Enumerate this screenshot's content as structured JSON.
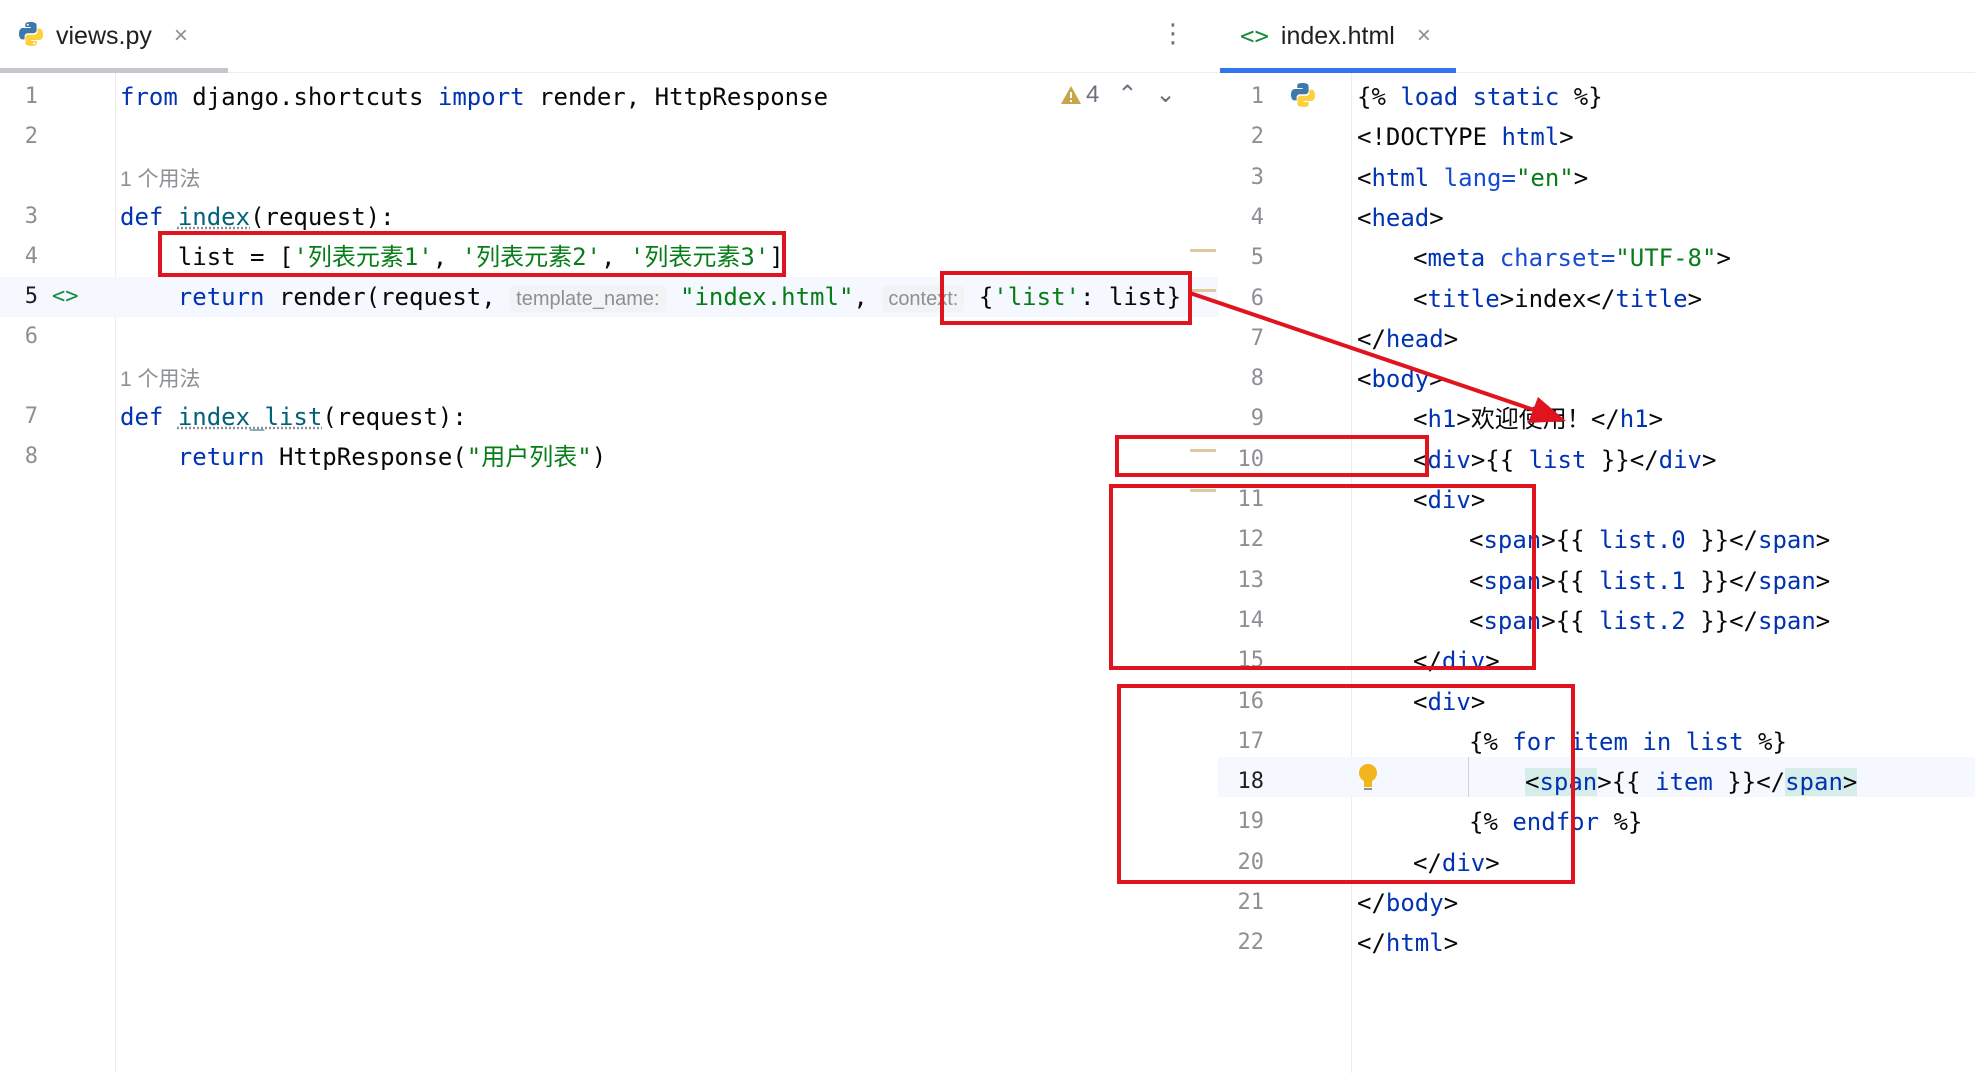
{
  "left_tab": {
    "filename": "views.py",
    "close": "×"
  },
  "right_tab": {
    "filename": "index.html",
    "close": "×"
  },
  "left_menu": "⋮",
  "warning": {
    "count": "4",
    "up": "⌃",
    "down": "⌄"
  },
  "colors": {
    "accent": "#3574f0",
    "highlight_box": "#e0141e",
    "arrow": "#e0141e"
  },
  "left_editor": {
    "line_numbers": [
      "1",
      "2",
      "3",
      "4",
      "5",
      "6",
      "7",
      "8"
    ],
    "usages": [
      "1 个用法",
      "1 个用法"
    ],
    "l1": {
      "from": "from",
      "module": " django.shortcuts ",
      "import": "import",
      "names": " render, HttpResponse"
    },
    "l3": {
      "def": "def",
      "space": " ",
      "name": "index",
      "params": "(request):"
    },
    "l4": {
      "indent": "    ",
      "var": "list = [",
      "s1": "'列表元素1'",
      "c1": ", ",
      "s2": "'列表元素2'",
      "c2": ", ",
      "s3": "'列表元素3'",
      "end": "]"
    },
    "l5": {
      "ret": "return",
      "call": " render(request, ",
      "hint1": "template_name:",
      "arg1": "\"index.html\"",
      "comma": ", ",
      "hint2": "context:",
      "ctx_open": "{",
      "ctx_key": "'list'",
      "ctx_rest": ": list}",
      "gutter": "<>"
    },
    "l7": {
      "def": "def",
      "space": " ",
      "name": "index_list",
      "params": "(request):"
    },
    "l8": {
      "ret": "return",
      "call": " HttpResponse(",
      "arg": "\"用户列表\"",
      "end": ")"
    }
  },
  "right_editor": {
    "line_numbers": [
      "1",
      "2",
      "3",
      "4",
      "5",
      "6",
      "7",
      "8",
      "9",
      "10",
      "11",
      "12",
      "13",
      "14",
      "15",
      "16",
      "17",
      "18",
      "19",
      "20",
      "21",
      "22"
    ],
    "l1": {
      "open": "{% ",
      "load": "load static",
      "close": " %}"
    },
    "l2": {
      "a": "<!DOCTYPE ",
      "b": "html",
      ">": ">"
    },
    "l3": {
      "a": "<",
      "b": "html ",
      "attr": "lang=",
      "val": "\"en\"",
      "c": ">"
    },
    "l4": {
      "a": "<",
      "b": "head",
      "c": ">"
    },
    "l5": {
      "a": "<",
      "b": "meta ",
      "attr": "charset=",
      "val": "\"UTF-8\"",
      "c": ">"
    },
    "l6": {
      "a": "<",
      "b": "title",
      ">": ">",
      "text": "index",
      "c": "</",
      "d": "title",
      "e": ">"
    },
    "l7": {
      "a": "</",
      "b": "head",
      "c": ">"
    },
    "l8": {
      "a": "<",
      "b": "body",
      "c": ">"
    },
    "l9": {
      "a": "<",
      "b": "h1",
      "c": ">",
      "text": "欢迎使用！",
      "d": "</",
      "e": "h1",
      "f": ">"
    },
    "l10": {
      "a": "<",
      "b": "div",
      "c": ">{{ ",
      "var": "list",
      "d": " }}</",
      "e": "div",
      "f": ">"
    },
    "l11": {
      "a": "<",
      "b": "div",
      "c": ">"
    },
    "l12": {
      "a": "<",
      "b": "span",
      "c": ">{{ ",
      "var": "list.0",
      "d": " }}</",
      "e": "span",
      "f": ">"
    },
    "l13": {
      "a": "<",
      "b": "span",
      "c": ">{{ ",
      "var": "list.1",
      "d": " }}</",
      "e": "span",
      "f": ">"
    },
    "l14": {
      "a": "<",
      "b": "span",
      "c": ">{{ ",
      "var": "list.2",
      "d": " }}</",
      "e": "span",
      "f": ">"
    },
    "l15": {
      "a": "</",
      "b": "div",
      "c": ">"
    },
    "l16": {
      "a": "<",
      "b": "div",
      "c": ">"
    },
    "l17": {
      "open": "{% ",
      "kw": "for item in list",
      "close": " %}"
    },
    "l18": {
      "a": "<",
      "b": "span",
      "c": ">{{ ",
      "var": "item",
      "d": " }}</",
      "e": "span",
      "f": ">"
    },
    "l19": {
      "open": "{% ",
      "kw": "endfor",
      "close": " %}"
    },
    "l20": {
      "a": "</",
      "b": "div",
      "c": ">"
    },
    "l21": {
      "a": "</",
      "b": "body",
      "c": ">"
    },
    "l22": {
      "a": "</",
      "b": "html",
      "c": ">"
    }
  }
}
